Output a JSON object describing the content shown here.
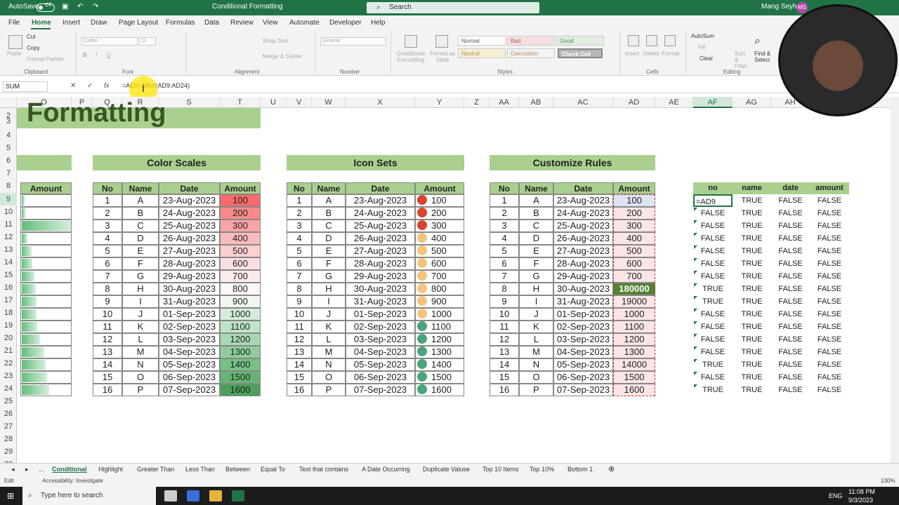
{
  "titlebar": {
    "autosave": "AutoSave",
    "toggle": "Off",
    "doc_title": "Conditional Formatting",
    "search": "Search",
    "user": "Mang Seyha",
    "initials": "MS"
  },
  "menu": [
    "File",
    "Home",
    "Insert",
    "Draw",
    "Page Layout",
    "Formulas",
    "Data",
    "Review",
    "View",
    "Automate",
    "Developer",
    "Help"
  ],
  "ribbon": {
    "groups": [
      "Clipboard",
      "Font",
      "Alignment",
      "Number",
      "Styles",
      "Cells",
      "Editing"
    ],
    "paste": "Paste",
    "cut": "Cut",
    "copy": "Copy",
    "format_painter": "Format Painter",
    "font_name": "Calibri",
    "font_size": "11",
    "wrap": "Wrap Text",
    "merge": "Merge & Center",
    "number_format": "General",
    "cond_format": "Conditional Formatting",
    "format_table": "Format as Table",
    "styles": [
      "Normal",
      "Bad",
      "Good",
      "Neutral",
      "Calculation",
      "Check Cell"
    ],
    "insert": "Insert",
    "delete": "Delete",
    "format": "Format",
    "autosum": "AutoSum",
    "fill": "Fill",
    "clear": "Clear",
    "sort": "Sort & Filter",
    "find": "Find & Select"
  },
  "formula_bar": {
    "name_box": "SUM",
    "formula": "=AD9=MAX(AD9:AD24)"
  },
  "columns": [
    "O",
    "P",
    "Q",
    "R",
    "S",
    "T",
    "U",
    "V",
    "W",
    "X",
    "Y",
    "Z",
    "AA",
    "AB",
    "AC",
    "AD",
    "AE",
    "AF",
    "AG",
    "AH"
  ],
  "rows": [
    "2",
    "3",
    "4",
    "5",
    "6",
    "7",
    "8",
    "9",
    "10",
    "11",
    "12",
    "13",
    "14",
    "15",
    "16",
    "17",
    "18",
    "19",
    "20",
    "21",
    "22",
    "23",
    "24",
    "25",
    "26",
    "27",
    "28",
    "29",
    "30"
  ],
  "sheet": {
    "title": "Formatting",
    "section_titles": {
      "color_scales": "Color Scales",
      "icon_sets": "Icon Sets",
      "customize": "Customize Rules"
    },
    "amount_header": "Amount",
    "headers": [
      "No",
      "Name",
      "Date",
      "Amount"
    ],
    "nos": [
      "1",
      "2",
      "3",
      "4",
      "5",
      "6",
      "7",
      "8",
      "9",
      "10",
      "11",
      "12",
      "13",
      "14",
      "15",
      "16"
    ],
    "names": [
      "A",
      "B",
      "C",
      "D",
      "E",
      "F",
      "G",
      "H",
      "I",
      "J",
      "K",
      "L",
      "M",
      "N",
      "O",
      "P"
    ],
    "dates": [
      "23-Aug-2023",
      "24-Aug-2023",
      "25-Aug-2023",
      "26-Aug-2023",
      "27-Aug-2023",
      "28-Aug-2023",
      "29-Aug-2023",
      "30-Aug-2023",
      "31-Aug-2023",
      "01-Sep-2023",
      "02-Sep-2023",
      "03-Sep-2023",
      "04-Sep-2023",
      "05-Sep-2023",
      "06-Sep-2023",
      "07-Sep-2023"
    ],
    "amounts": [
      "100",
      "200",
      "300",
      "400",
      "500",
      "600",
      "700",
      "800",
      "900",
      "1000",
      "1100",
      "1200",
      "1300",
      "1400",
      "1500",
      "1600"
    ],
    "custom_amounts": [
      "100",
      "200",
      "300",
      "400",
      "500",
      "600",
      "700",
      "180000",
      "19000",
      "1000",
      "1100",
      "1200",
      "1300",
      "14000",
      "1500",
      "1600"
    ],
    "bar_fractions": [
      0.05,
      0.07,
      1.0,
      0.12,
      0.2,
      0.22,
      0.26,
      0.28,
      0.3,
      0.3,
      0.32,
      0.37,
      0.45,
      0.48,
      0.52,
      0.55
    ],
    "scale_colors": [
      "#f8696b",
      "#f8898a",
      "#f9a5a6",
      "#fbbcbd",
      "#fccfd0",
      "#fddfe0",
      "#fdeaea",
      "#fbf5f5",
      "#eef7f0",
      "#d4ecd9",
      "#c0e3c7",
      "#a8d8b2",
      "#8fcd9c",
      "#76c186",
      "#63b672",
      "#4da05b"
    ],
    "icon_colors": [
      "#d9442f",
      "#d9442f",
      "#d9442f",
      "#f2c47d",
      "#f2c47d",
      "#f2c47d",
      "#f2c47d",
      "#f2c47d",
      "#f2c47d",
      "#f2c47d",
      "#4aa57a",
      "#4aa57a",
      "#4aa57a",
      "#4aa57a",
      "#4aa57a",
      "#4aa57a"
    ],
    "test_headers": [
      "no",
      "name",
      "date",
      "amount"
    ],
    "test_first": "=AD9",
    "test_no": [
      "FALSE",
      "FALSE",
      "FALSE",
      "FALSE",
      "FALSE",
      "FALSE",
      "TRUE",
      "TRUE",
      "FALSE",
      "FALSE",
      "FALSE",
      "FALSE",
      "TRUE",
      "FALSE",
      "TRUE"
    ],
    "test_name": "TRUE",
    "test_date": "FALSE",
    "test_amount": "FALSE"
  },
  "tabs": [
    "Conditional",
    "Highlight",
    "Greater Than",
    "Less Than",
    "Between",
    "Equal To",
    "Text that contains",
    "A Date Occurring",
    "Duplicate Valuse",
    "Top 10 Items",
    "Top 10%",
    "Bottom 1"
  ],
  "status": {
    "mode": "Edit",
    "accessibility": "Accessibility: Investigate",
    "zoom": "130%"
  },
  "taskbar": {
    "search": "Type here to search",
    "time": "11:08 PM",
    "date": "9/3/2023",
    "lang": "ENG"
  },
  "colors": {
    "accent": "#217346",
    "header_green": "#a9d08e",
    "dark_green": "#548235"
  }
}
